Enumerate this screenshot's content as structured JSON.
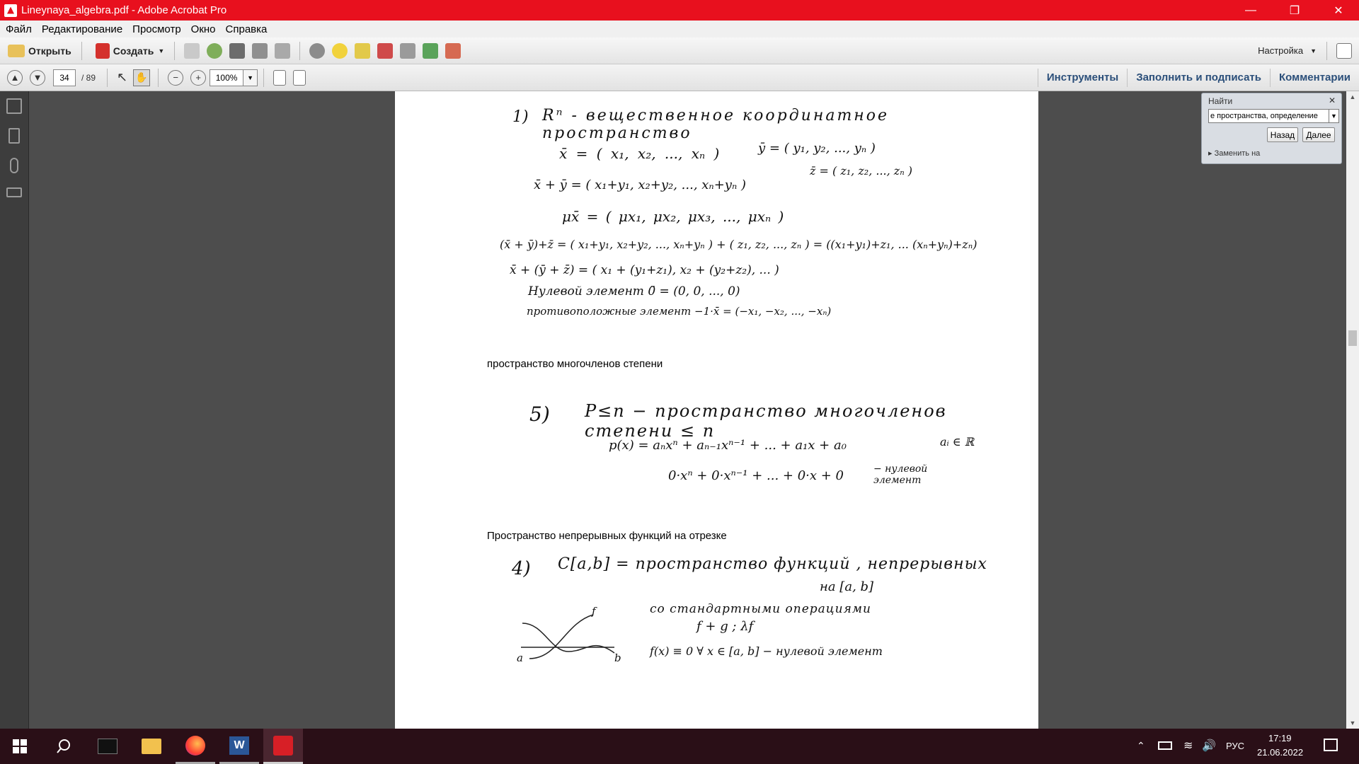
{
  "window": {
    "title": "Lineynaya_algebra.pdf - Adobe Acrobat Pro"
  },
  "menu": {
    "items": [
      "Файл",
      "Редактирование",
      "Просмотр",
      "Окно",
      "Справка"
    ]
  },
  "toolbar": {
    "open_label": "Открыть",
    "create_label": "Создать",
    "customize_label": "Настройка"
  },
  "navigation": {
    "current_page": "34",
    "total_pages": "/ 89",
    "zoom": "100%"
  },
  "panels": {
    "tools": "Инструменты",
    "fill_sign": "Заполнить и подписать",
    "comments": "Комментарии"
  },
  "find": {
    "title": "Найти",
    "query": "е пространства, определение",
    "back_label": "Назад",
    "next_label": "Далее",
    "replace_label": "Заменить на"
  },
  "document": {
    "caption_polynomials": "пространство многочленов степени",
    "caption_continuous": "Пространство непрерывных функций на отрезке",
    "hw1": {
      "n": "1)",
      "title": "Rⁿ - вещественное координатное пространство",
      "l1": "x̄ = ( x₁, x₂, ..., xₙ )",
      "l1b": "ȳ = ( y₁, y₂, ..., yₙ )",
      "l1c": "z̄ = ( z₁, z₂, ..., zₙ )",
      "l2": "x̄ + ȳ = ( x₁+y₁, x₂+y₂, ..., xₙ+yₙ )",
      "l3": "μx̄ = ( μx₁, μx₂, μx₃, ..., μxₙ )",
      "l4": "(x̄ + ȳ)+z̄ = ( x₁+y₁, x₂+y₂, ..., xₙ+yₙ ) + ( z₁, z₂, ..., zₙ ) = ((x₁+y₁)+z₁, ... (xₙ+yₙ)+zₙ)",
      "l5": "x̄ + (ȳ + z̄) = ( x₁ + (y₁+z₁), x₂ + (y₂+z₂), ...   )",
      "l6": "Нулевой элемент   0̄ = (0, 0, ..., 0)",
      "l7": "противоположные элемент   −1·x̄ = (−x₁, −x₂, ..., −xₙ)"
    },
    "hw2": {
      "n": "5)",
      "title": "P≤n − пространство многочленов степени ≤ n",
      "l1": "p(x) = aₙxⁿ + aₙ₋₁xⁿ⁻¹ + ...  +  a₁x + a₀",
      "l1b": "aᵢ ∈ ℝ",
      "l2": "0·xⁿ + 0·xⁿ⁻¹ + ...  +  0·x + 0",
      "l2b": "− нулевой элемент"
    },
    "hw3": {
      "n": "4)",
      "title": "C[a,b] = пространство функций , непрерывных",
      "title2": "на [a, b]",
      "l1": "со стандартными операциями",
      "l2": "f + g ;  λf",
      "l3": "f(x) ≡ 0  ∀ x ∈ [a, b]  − нулевой элемент",
      "graph_a": "a",
      "graph_b": "b",
      "graph_f": "f"
    }
  },
  "taskbar": {
    "language": "РУС",
    "time": "17:19",
    "date": "21.06.2022"
  }
}
